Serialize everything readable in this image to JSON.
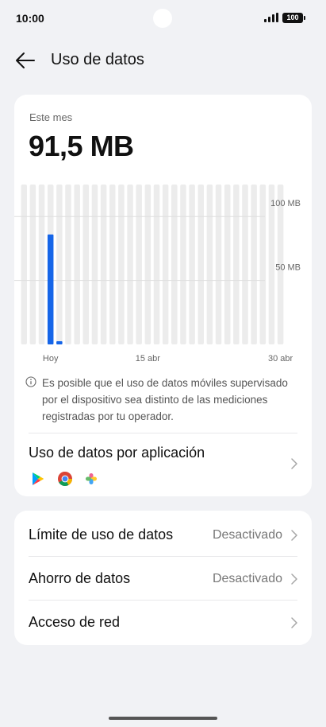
{
  "status": {
    "time": "10:00",
    "battery": "100"
  },
  "header": {
    "title": "Uso de datos"
  },
  "usage": {
    "period_label": "Este mes",
    "total": "91,5 MB",
    "info_text": "Es posible que el uso de datos móviles supervisado por el dispositivo sea distinto de las mediciones registradas por tu operador."
  },
  "chart_data": {
    "type": "bar",
    "unit": "MB",
    "ylim": [
      0,
      125
    ],
    "y_ticks": [
      {
        "value": 100,
        "label": "100 MB"
      },
      {
        "value": 50,
        "label": "50 MB"
      }
    ],
    "x_tick_labels": [
      {
        "day": 4,
        "label": "Hoy"
      },
      {
        "day": 15,
        "label": "15 abr"
      },
      {
        "day": 30,
        "label": "30 abr"
      }
    ],
    "day_count": 30,
    "values": [
      0,
      0,
      0,
      86,
      2.5,
      0,
      0,
      0,
      0,
      0,
      0,
      0,
      0,
      0,
      0,
      0,
      0,
      0,
      0,
      0,
      0,
      0,
      0,
      0,
      0,
      0,
      0,
      0,
      0,
      0
    ],
    "bar_color": "#1565e8",
    "track_color": "#ececec"
  },
  "apps": {
    "title": "Uso de datos por aplicación",
    "icons": [
      "play-store-icon",
      "chrome-icon",
      "app-icon"
    ]
  },
  "settings": {
    "items": [
      {
        "label": "Límite de uso de datos",
        "value": "Desactivado"
      },
      {
        "label": "Ahorro de datos",
        "value": "Desactivado"
      },
      {
        "label": "Acceso de red",
        "value": ""
      }
    ]
  }
}
